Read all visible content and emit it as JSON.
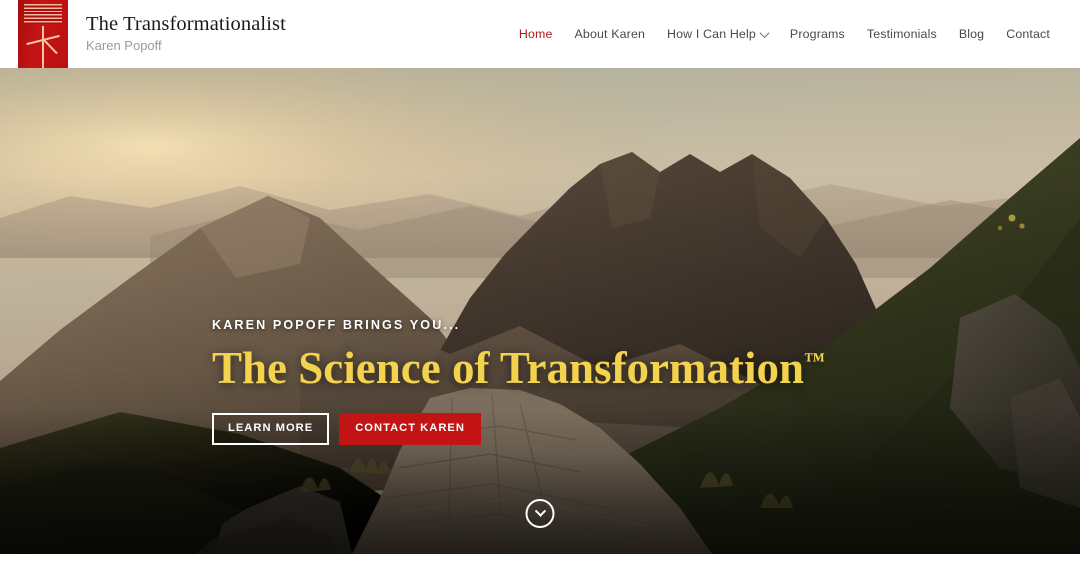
{
  "header": {
    "logo_icon": "transformationalist-logo-mark",
    "brand_title": "The Transformationalist",
    "brand_subtitle": "Karen Popoff",
    "nav": [
      {
        "label": "Home",
        "active": true,
        "has_dropdown": false
      },
      {
        "label": "About Karen",
        "active": false,
        "has_dropdown": false
      },
      {
        "label": "How I Can Help",
        "active": false,
        "has_dropdown": true
      },
      {
        "label": "Programs",
        "active": false,
        "has_dropdown": false
      },
      {
        "label": "Testimonials",
        "active": false,
        "has_dropdown": false
      },
      {
        "label": "Blog",
        "active": false,
        "has_dropdown": false
      },
      {
        "label": "Contact",
        "active": false,
        "has_dropdown": false
      }
    ]
  },
  "hero": {
    "eyebrow": "KAREN POPOFF BRINGS YOU...",
    "title": "The Science of Transformation",
    "title_trademark": "™",
    "buttons": {
      "primary": "LEARN MORE",
      "secondary": "CONTACT KAREN"
    },
    "scroll_indicator_icon": "chevron-down-circle-icon",
    "background_description": "Sunrise over a mountain ridge with a cobblestone footpath"
  },
  "colors": {
    "brand_red": "#c21414",
    "logo_red": "#bb1111",
    "accent_gold": "#f3d24e",
    "nav_active": "#b01818",
    "nav_text": "#4a4a4a",
    "brand_subtitle": "#9a9a9a",
    "header_bg": "#ffffff"
  }
}
